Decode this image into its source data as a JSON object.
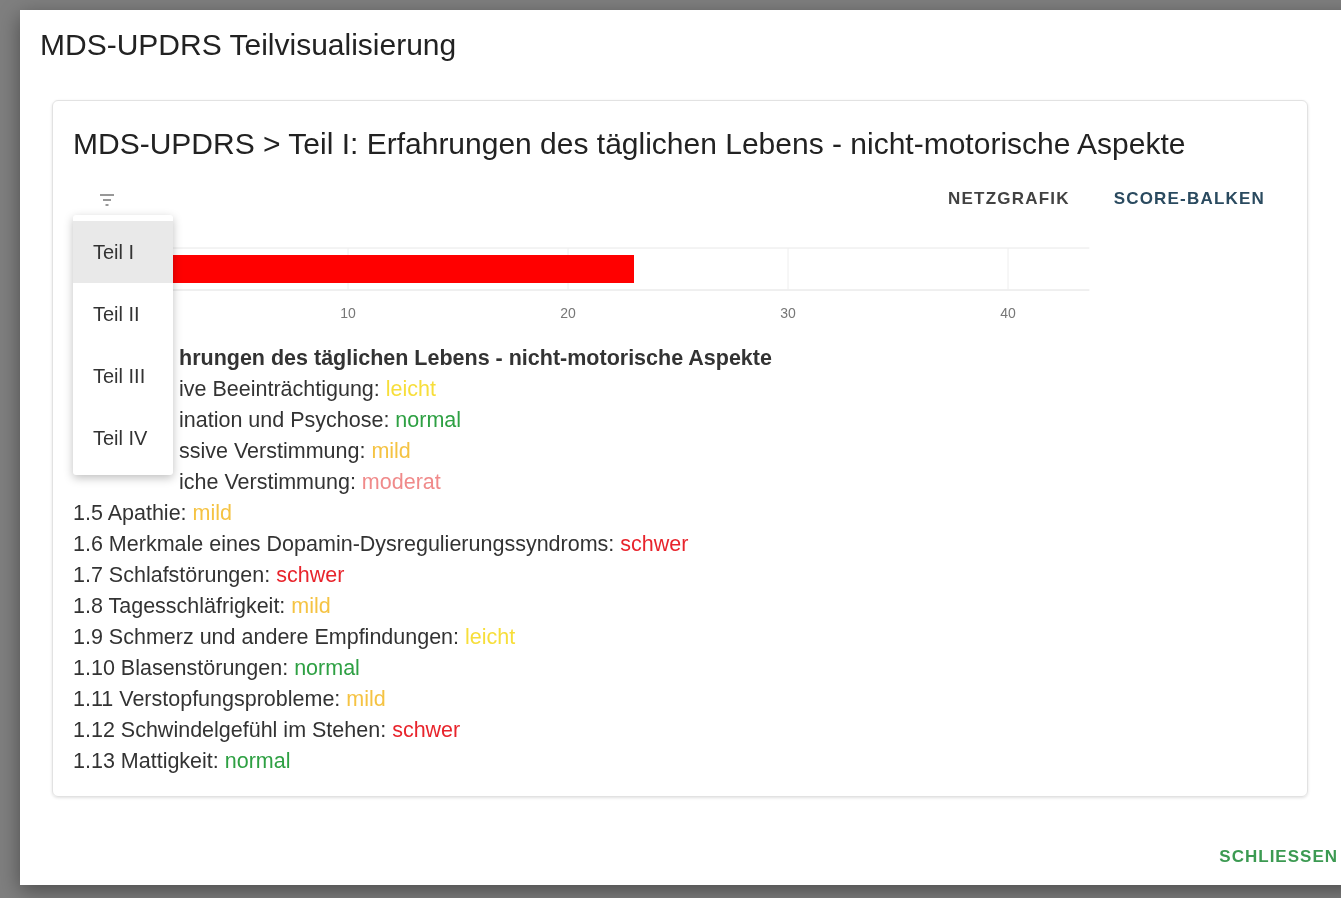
{
  "dialog": {
    "title": "MDS-UPDRS Teilvisualisierung",
    "card": {
      "heading": "MDS-UPDRS > Teil I: Erfahrungen des täglichen Lebens - nicht-motorische Aspekte",
      "tabs": [
        {
          "label": "NETZGRAFIK",
          "selected": false
        },
        {
          "label": "SCORE-BALKEN",
          "selected": true
        }
      ],
      "menu": {
        "items": [
          {
            "label": "Teil I",
            "selected": true
          },
          {
            "label": "Teil II",
            "selected": false
          },
          {
            "label": "Teil III",
            "selected": false
          },
          {
            "label": "Teil IV",
            "selected": false
          }
        ]
      },
      "chart_data": {
        "type": "bar",
        "orientation": "horizontal",
        "series": [
          {
            "color": "#ff0000",
            "values": [
              23
            ]
          }
        ],
        "xlim": [
          0,
          43.7
        ],
        "xticks": [
          10,
          20,
          30,
          40
        ],
        "grid": true
      },
      "section_heading": "hrungen des täglichen Lebens - nicht-motorische Aspekte",
      "items_partly_hidden": [
        {
          "label": "ive Beeinträchtigung:",
          "value": "leicht",
          "color": "#f7de3a"
        },
        {
          "label": "ination und Psychose:",
          "value": "normal",
          "color": "#2ea043"
        },
        {
          "label": "ssive Verstimmung:",
          "value": "mild",
          "color": "#f5c343"
        },
        {
          "label": "iche Verstimmung:",
          "value": "moderat",
          "color": "#f08a8a"
        }
      ],
      "items": [
        {
          "label": "1.5 Apathie:",
          "value": "mild",
          "color": "#f5c343"
        },
        {
          "label": "1.6 Merkmale eines Dopamin-Dysregulierungssyndroms:",
          "value": "schwer",
          "color": "#e8242c"
        },
        {
          "label": "1.7 Schlafstörungen:",
          "value": "schwer",
          "color": "#e8242c"
        },
        {
          "label": "1.8 Tagesschläfrigkeit:",
          "value": "mild",
          "color": "#f5c343"
        },
        {
          "label": "1.9 Schmerz und andere Empfindungen:",
          "value": "leicht",
          "color": "#f7de3a"
        },
        {
          "label": "1.10 Blasenstörungen:",
          "value": "normal",
          "color": "#2ea043"
        },
        {
          "label": "1.11 Verstopfungsprobleme:",
          "value": "mild",
          "color": "#f5c343"
        },
        {
          "label": "1.12 Schwindelgefühl im Stehen:",
          "value": "schwer",
          "color": "#e8242c"
        },
        {
          "label": "1.13 Mattigkeit:",
          "value": "normal",
          "color": "#2ea043"
        }
      ]
    },
    "close_button": "SCHLIESSEN"
  }
}
